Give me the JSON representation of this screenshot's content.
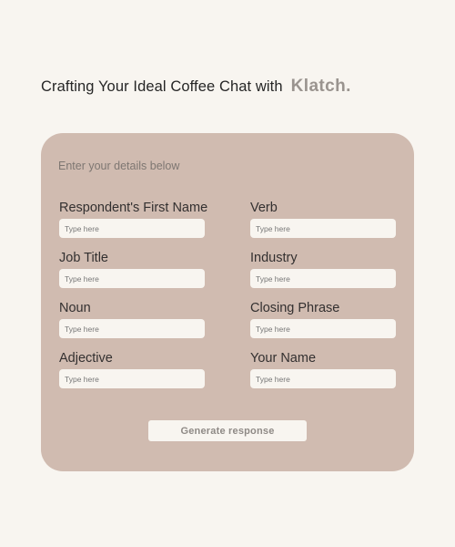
{
  "header": {
    "title": "Crafting Your Ideal Coffee Chat with",
    "brand": "Klatch."
  },
  "form": {
    "hint": "Enter your details below",
    "placeholder": "Type here",
    "fields": {
      "respondent_first_name": {
        "label": "Respondent's First Name",
        "value": ""
      },
      "verb": {
        "label": "Verb",
        "value": ""
      },
      "job_title": {
        "label": "Job Title",
        "value": ""
      },
      "industry": {
        "label": "Industry",
        "value": ""
      },
      "noun": {
        "label": "Noun",
        "value": ""
      },
      "closing_phrase": {
        "label": "Closing Phrase",
        "value": ""
      },
      "adjective": {
        "label": "Adjective",
        "value": ""
      },
      "your_name": {
        "label": "Your Name",
        "value": ""
      }
    },
    "submit_label": "Generate response"
  },
  "colors": {
    "background": "#f8f5f0",
    "card": "#d0bbb0",
    "brand": "#9a948f",
    "text": "#262626"
  }
}
